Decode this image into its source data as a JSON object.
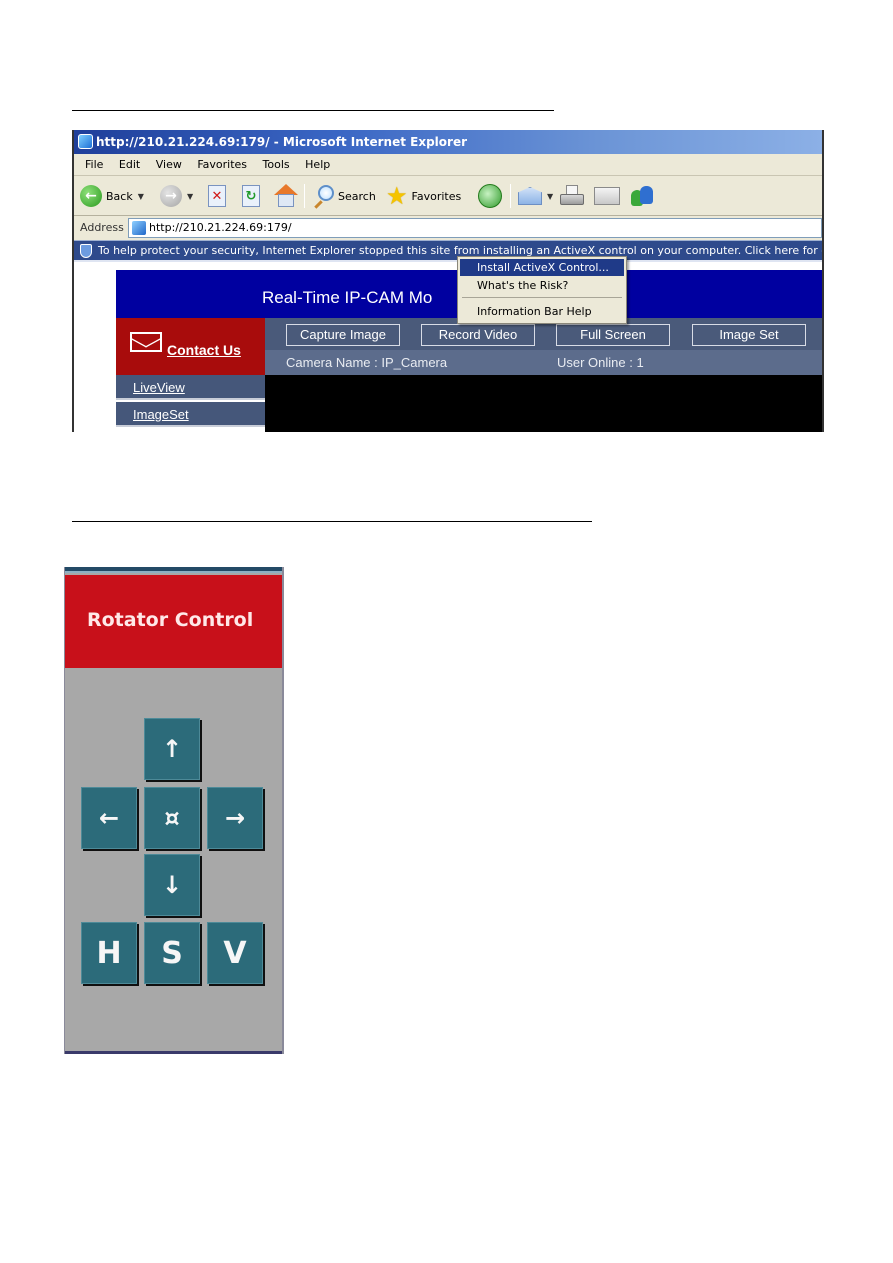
{
  "ie_window": {
    "title": "http://210.21.224.69:179/ - Microsoft Internet Explorer",
    "menu": [
      "File",
      "Edit",
      "View",
      "Favorites",
      "Tools",
      "Help"
    ],
    "toolbar": {
      "back_label": "Back",
      "search_label": "Search",
      "favorites_label": "Favorites"
    },
    "address": {
      "label": "Address",
      "value": "http://210.21.224.69:179/"
    },
    "infobar_text": "To help protect your security, Internet Explorer stopped this site from installing an ActiveX control on your computer. Click here for options...",
    "dropdown_menu": {
      "items": [
        "Install ActiveX Control...",
        "What's the Risk?",
        "Information Bar Help"
      ],
      "selected_index": 0
    }
  },
  "webpage": {
    "banner_title": "Real-Time IP-CAM Mo",
    "contact_label": "Contact Us",
    "nav": [
      "LiveView",
      "ImageSet"
    ],
    "buttons": [
      "Capture Image",
      "Record Video",
      "Full Screen",
      "Image Set"
    ],
    "camera_name_text": "Camera Name : IP_Camera",
    "user_online_text": "User Online : 1"
  },
  "rotator": {
    "title": "Rotator Control",
    "up_glyph": "↑",
    "left_glyph": "←",
    "center_glyph": "¤",
    "right_glyph": "→",
    "down_glyph": "↓",
    "h_label": "H",
    "s_label": "S",
    "v_label": "V"
  }
}
